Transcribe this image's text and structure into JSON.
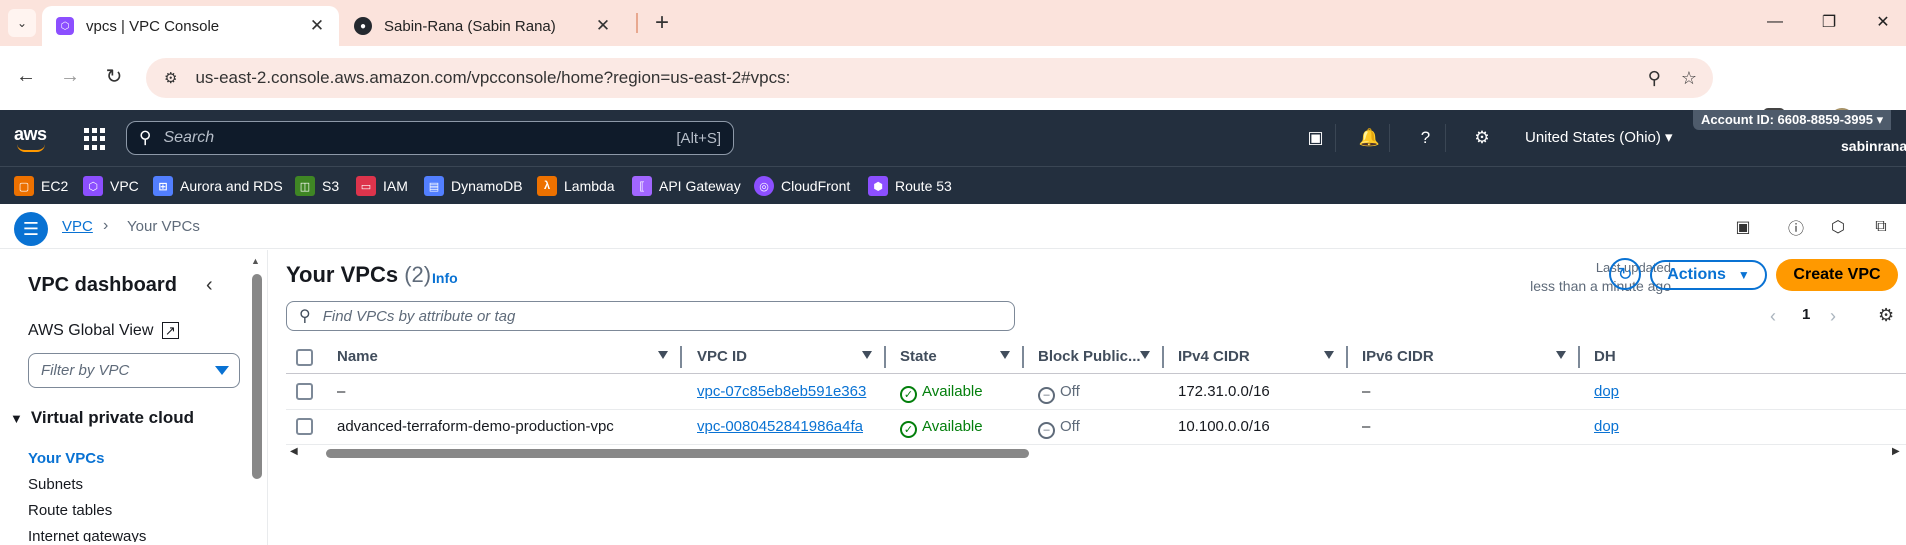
{
  "browser": {
    "tabs": [
      {
        "title": "vpcs | VPC Console",
        "icon": "vpc-favicon",
        "active": true
      },
      {
        "title": "Sabin-Rana (Sabin Rana)",
        "icon": "github-favicon",
        "active": false
      }
    ],
    "url": "us-east-2.console.aws.amazon.com/vpcconsole/home?region=us-east-2#vpcs:"
  },
  "aws_nav": {
    "logo": "aws",
    "search_placeholder": "Search",
    "search_shortcut": "[Alt+S]",
    "region": "United States (Ohio) ▾",
    "account": "Account ID: 6608-8859-3995 ▾",
    "user": "sabinrana"
  },
  "favorites": [
    {
      "label": "EC2",
      "color": "#ed7100"
    },
    {
      "label": "VPC",
      "color": "#8c4fff"
    },
    {
      "label": "Aurora and RDS",
      "color": "#527fff"
    },
    {
      "label": "S3",
      "color": "#3f8624"
    },
    {
      "label": "IAM",
      "color": "#dd344c"
    },
    {
      "label": "DynamoDB",
      "color": "#527fff"
    },
    {
      "label": "Lambda",
      "color": "#ed7100"
    },
    {
      "label": "API Gateway",
      "color": "#a166ff"
    },
    {
      "label": "CloudFront",
      "color": "#8c4fff"
    },
    {
      "label": "Route 53",
      "color": "#8c4fff"
    }
  ],
  "breadcrumb": {
    "parent": "VPC",
    "current": "Your VPCs"
  },
  "sidebar": {
    "title": "VPC dashboard",
    "global_view": "AWS Global View",
    "filter_placeholder": "Filter by VPC",
    "section": "Virtual private cloud",
    "items": [
      "Your VPCs",
      "Subnets",
      "Route tables",
      "Internet gateways"
    ]
  },
  "main": {
    "title": "Your VPCs",
    "count": "(2)",
    "info": "Info",
    "last_updated_label": "Last updated",
    "last_updated_value": "less than a minute ago",
    "actions_label": "Actions",
    "create_label": "Create VPC",
    "find_placeholder": "Find VPCs by attribute or tag",
    "page": "1"
  },
  "table": {
    "columns": [
      "Name",
      "VPC ID",
      "State",
      "Block Public...",
      "IPv4 CIDR",
      "IPv6 CIDR",
      "DH"
    ],
    "rows": [
      {
        "name": "–",
        "vpc_id": "vpc-07c85eb8eb591e363",
        "state": "Available",
        "block": "Off",
        "ipv4": "172.31.0.0/16",
        "ipv6": "–",
        "dh": "dop"
      },
      {
        "name": "advanced-terraform-demo-production-vpc",
        "vpc_id": "vpc-0080452841986a4fa",
        "state": "Available",
        "block": "Off",
        "ipv4": "10.100.0.0/16",
        "ipv6": "–",
        "dh": "dop"
      }
    ]
  },
  "colors": {
    "aws_dark": "#232f3e",
    "link_blue": "#0972d3",
    "aws_orange": "#ff9900",
    "ok_green": "#037f0c"
  }
}
